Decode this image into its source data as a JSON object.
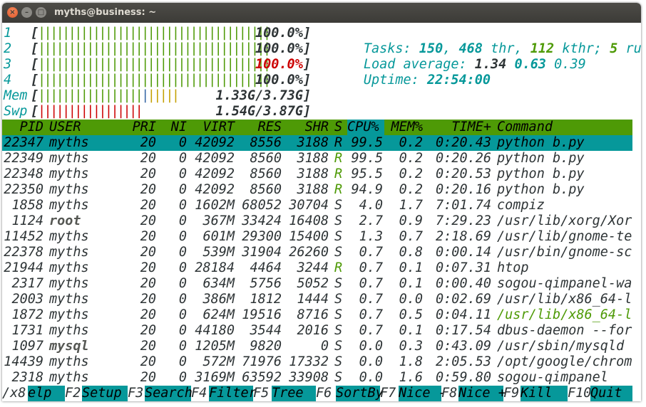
{
  "window": {
    "title": "myths@business: ~",
    "close": "×",
    "minimize": "–",
    "maximize": "□"
  },
  "cpus": [
    {
      "num": "1",
      "pct": "100.0%",
      "pct_color": "#2e3436"
    },
    {
      "num": "2",
      "pct": "100.0%",
      "pct_color": "#2e3436"
    },
    {
      "num": "3",
      "pct": "100.0%",
      "pct_color": "#cc0000"
    },
    {
      "num": "4",
      "pct": "100.0%",
      "pct_color": "#2e3436"
    }
  ],
  "mem": {
    "label": "Mem",
    "value": "1.33G/3.73G",
    "used_fraction": 0.36
  },
  "swp": {
    "label": "Swp",
    "value": "1.54G/3.87G",
    "used_fraction": 0.4
  },
  "summary": {
    "tasks_label": "Tasks:",
    "tasks": "150",
    "thr": "468",
    "thr_label": "thr,",
    "kthr": "112",
    "kthr_label": "kthr;",
    "running": "5",
    "running_label": "running",
    "load_label": "Load average:",
    "load1": "1.34",
    "load5": "0.63",
    "load15": "0.39",
    "uptime_label": "Uptime:",
    "uptime": "22:54:00"
  },
  "columns": [
    "PID",
    "USER",
    "PRI",
    "NI",
    "VIRT",
    "RES",
    "SHR",
    "S",
    "CPU%",
    "MEM%",
    "TIME+",
    "Command"
  ],
  "processes": [
    {
      "pid": "22347",
      "user": "myths",
      "pri": "20",
      "ni": "0",
      "virt": "42092",
      "res": "8556",
      "shr": "3188",
      "s": "R",
      "cpu": "99.5",
      "mem": "0.2",
      "time": "0:20.43",
      "cmd": "python b.py"
    },
    {
      "pid": "22349",
      "user": "myths",
      "pri": "20",
      "ni": "0",
      "virt": "42092",
      "res": "8560",
      "shr": "3188",
      "s": "R",
      "cpu": "99.5",
      "mem": "0.2",
      "time": "0:20.26",
      "cmd": "python b.py"
    },
    {
      "pid": "22348",
      "user": "myths",
      "pri": "20",
      "ni": "0",
      "virt": "42092",
      "res": "8560",
      "shr": "3188",
      "s": "R",
      "cpu": "95.5",
      "mem": "0.2",
      "time": "0:20.53",
      "cmd": "python b.py"
    },
    {
      "pid": "22350",
      "user": "myths",
      "pri": "20",
      "ni": "0",
      "virt": "42092",
      "res": "8560",
      "shr": "3188",
      "s": "R",
      "cpu": "94.9",
      "mem": "0.2",
      "time": "0:20.16",
      "cmd": "python b.py"
    },
    {
      "pid": "1858",
      "user": "myths",
      "pri": "20",
      "ni": "0",
      "virt": "1602M",
      "res": "68052",
      "shr": "30704",
      "s": "S",
      "cpu": "4.0",
      "mem": "1.7",
      "time": "7:01.74",
      "cmd": "compiz"
    },
    {
      "pid": "1124",
      "user": "root",
      "pri": "20",
      "ni": "0",
      "virt": "367M",
      "res": "33424",
      "shr": "16408",
      "s": "S",
      "cpu": "2.7",
      "mem": "0.9",
      "time": "7:29.23",
      "cmd": "/usr/lib/xorg/Xor"
    },
    {
      "pid": "11452",
      "user": "myths",
      "pri": "20",
      "ni": "0",
      "virt": "601M",
      "res": "29300",
      "shr": "15400",
      "s": "S",
      "cpu": "1.3",
      "mem": "0.7",
      "time": "2:18.69",
      "cmd": "/usr/lib/gnome-te"
    },
    {
      "pid": "22378",
      "user": "myths",
      "pri": "20",
      "ni": "0",
      "virt": "539M",
      "res": "31904",
      "shr": "26260",
      "s": "S",
      "cpu": "0.7",
      "mem": "0.8",
      "time": "0:00.14",
      "cmd": "/usr/bin/gnome-sc"
    },
    {
      "pid": "21944",
      "user": "myths",
      "pri": "20",
      "ni": "0",
      "virt": "28184",
      "res": "4464",
      "shr": "3244",
      "s": "R",
      "cpu": "0.7",
      "mem": "0.1",
      "time": "0:07.31",
      "cmd": "htop"
    },
    {
      "pid": "2317",
      "user": "myths",
      "pri": "20",
      "ni": "0",
      "virt": "634M",
      "res": "5756",
      "shr": "5052",
      "s": "S",
      "cpu": "0.7",
      "mem": "0.1",
      "time": "0:00.40",
      "cmd": "sogou-qimpanel-wa"
    },
    {
      "pid": "2003",
      "user": "myths",
      "pri": "20",
      "ni": "0",
      "virt": "386M",
      "res": "1812",
      "shr": "1444",
      "s": "S",
      "cpu": "0.7",
      "mem": "0.0",
      "time": "0:02.69",
      "cmd": "/usr/lib/x86_64-l"
    },
    {
      "pid": "1872",
      "user": "myths",
      "pri": "20",
      "ni": "0",
      "virt": "624M",
      "res": "19516",
      "shr": "8716",
      "s": "S",
      "cpu": "0.7",
      "mem": "0.5",
      "time": "0:04.11",
      "cmd": "/usr/lib/x86_64-l"
    },
    {
      "pid": "1731",
      "user": "myths",
      "pri": "20",
      "ni": "0",
      "virt": "44180",
      "res": "3544",
      "shr": "2016",
      "s": "S",
      "cpu": "0.7",
      "mem": "0.1",
      "time": "0:17.54",
      "cmd": "dbus-daemon --for"
    },
    {
      "pid": "1097",
      "user": "mysql",
      "pri": "20",
      "ni": "0",
      "virt": "1205M",
      "res": "9820",
      "shr": "0",
      "s": "S",
      "cpu": "0.0",
      "mem": "0.3",
      "time": "0:43.09",
      "cmd": "/usr/sbin/mysqld"
    },
    {
      "pid": "14439",
      "user": "myths",
      "pri": "20",
      "ni": "0",
      "virt": "572M",
      "res": "71976",
      "shr": "17332",
      "s": "S",
      "cpu": "0.0",
      "mem": "1.8",
      "time": "2:05.53",
      "cmd": "/opt/google/chrom"
    },
    {
      "pid": "2318",
      "user": "myths",
      "pri": "20",
      "ni": "0",
      "virt": "3169M",
      "res": "63592",
      "shr": "33908",
      "s": "S",
      "cpu": "0.0",
      "mem": "1.6",
      "time": "0:59.80",
      "cmd": "sogou-qimpanel"
    }
  ],
  "function_keys": [
    {
      "key": "/x8",
      "label": "elp"
    },
    {
      "key": "F2",
      "label": "Setup"
    },
    {
      "key": "F3",
      "label": "Search"
    },
    {
      "key": "F4",
      "label": "Filter"
    },
    {
      "key": "F5",
      "label": "Tree"
    },
    {
      "key": "F6",
      "label": "SortBy"
    },
    {
      "key": "F7",
      "label": "Nice -"
    },
    {
      "key": "F8",
      "label": "Nice +"
    },
    {
      "key": "F9",
      "label": "Kill"
    },
    {
      "key": "F10",
      "label": "Quit"
    }
  ],
  "colors": {
    "green": "#4e9a06",
    "cyan": "#06989a",
    "red": "#cc0000",
    "text": "#2e3436",
    "yellow": "#c4a000",
    "blue": "#3465a4",
    "titlebar": "#3c3b37"
  }
}
